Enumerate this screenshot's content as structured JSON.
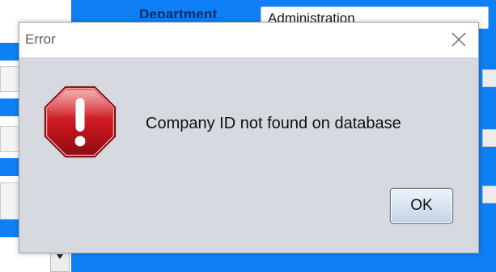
{
  "background_window": {
    "department_label": "Department",
    "department_value": "Administration"
  },
  "dialog": {
    "title": "Error",
    "message": "Company ID not found on database",
    "ok_label": "OK",
    "icon": "error-stop-icon",
    "close_icon": "close-icon"
  },
  "colors": {
    "background_blue": "#0f7ff5",
    "dialog_body": "#d6d9df",
    "icon_red": "#c8161d"
  }
}
